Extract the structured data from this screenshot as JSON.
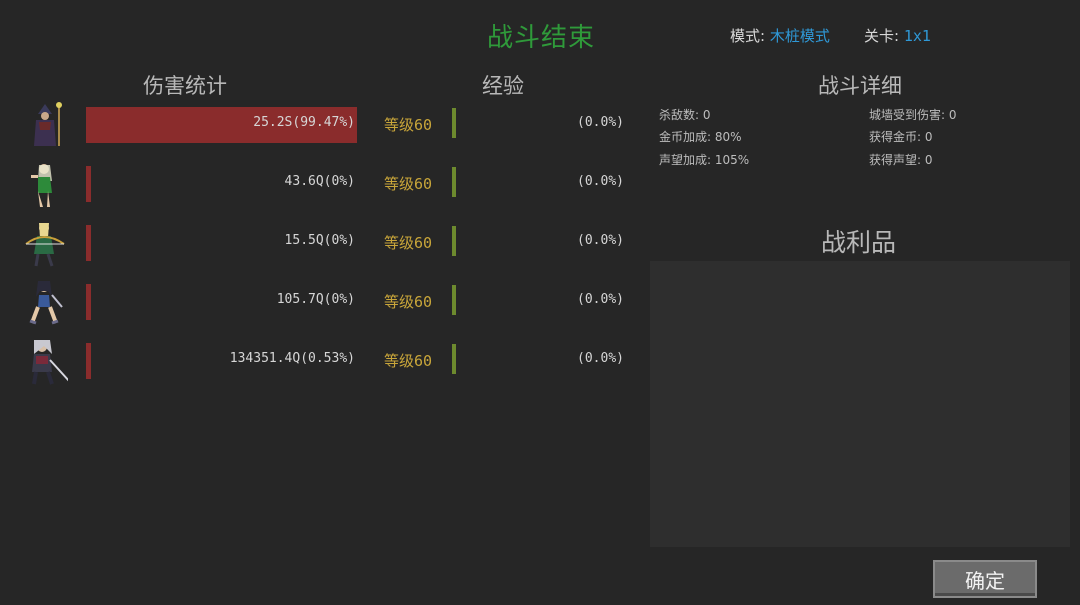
{
  "header": {
    "title": "战斗结束",
    "mode_label": "模式:",
    "mode_value": "木桩模式",
    "stage_label": "关卡:",
    "stage_value": "1x1"
  },
  "sections": {
    "damage": "伤害统计",
    "exp": "经验",
    "detail": "战斗详细",
    "loot": "战利品"
  },
  "heroes": [
    {
      "icon": "sorcerer-avatar-icon",
      "damage": "25.2S(99.47%)",
      "damage_share": 99.47,
      "level": "等级60",
      "exp": "(0.0%)"
    },
    {
      "icon": "elf-avatar-icon",
      "damage": "43.6Q(0%)",
      "damage_share": 0,
      "level": "等级60",
      "exp": "(0.0%)"
    },
    {
      "icon": "archer-avatar-icon",
      "damage": "15.5Q(0%)",
      "damage_share": 0,
      "level": "等级60",
      "exp": "(0.0%)"
    },
    {
      "icon": "warrior-woman-avatar-icon",
      "damage": "105.7Q(0%)",
      "damage_share": 0,
      "level": "等级60",
      "exp": "(0.0%)"
    },
    {
      "icon": "swordsman-avatar-icon",
      "damage": "134351.4Q(0.53%)",
      "damage_share": 0.53,
      "level": "等级60",
      "exp": "(0.0%)"
    }
  ],
  "details": {
    "kills": "杀敌数: 0",
    "wall_damage": "城墙受到伤害: 0",
    "gold_bonus": "金币加成: 80%",
    "gold_gain": "获得金币: 0",
    "fame_bonus": "声望加成: 105%",
    "fame_gain": "获得声望: 0"
  },
  "confirm_button": "确定",
  "colors": {
    "title": "#2f9a3a",
    "accent": "#2f98d6",
    "damage_bar": "#8a2c2c",
    "level": "#c9a63a",
    "exp_bar": "#6d8a2e"
  }
}
